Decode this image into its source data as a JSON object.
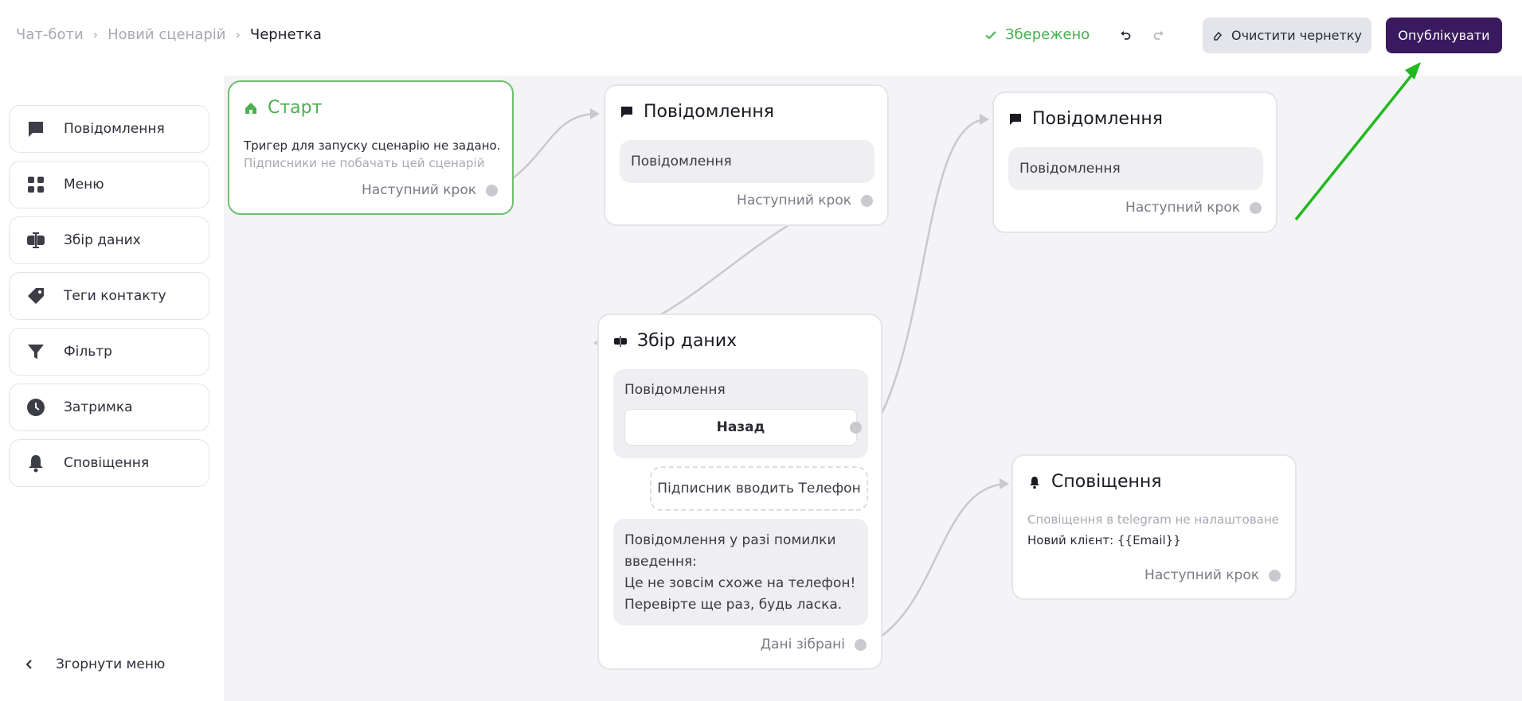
{
  "breadcrumb": {
    "item1": "Чат-боти",
    "item2": "Новий сценарій",
    "current": "Чернетка"
  },
  "header": {
    "saved": "Збережено",
    "clear_label": "Очистити чернетку",
    "publish_label": "Опублікувати"
  },
  "sidebar": {
    "items": [
      {
        "label": "Повідомлення",
        "icon": "message-icon"
      },
      {
        "label": "Меню",
        "icon": "grid-icon"
      },
      {
        "label": "Збір даних",
        "icon": "input-icon"
      },
      {
        "label": "Теги контакту",
        "icon": "tag-icon"
      },
      {
        "label": "Фільтр",
        "icon": "filter-icon"
      },
      {
        "label": "Затримка",
        "icon": "clock-icon"
      },
      {
        "label": "Сповіщення",
        "icon": "bell-icon"
      }
    ],
    "collapse_label": "Згорнути меню"
  },
  "nodes": {
    "start": {
      "title": "Старт",
      "trigger_text": "Тригер для запуску сценарію не задано.",
      "hint": "Підписники не побачать цей сценарій",
      "next": "Наступний крок"
    },
    "message1": {
      "title": "Повідомлення",
      "content": "Повідомлення",
      "next": "Наступний крок"
    },
    "message2": {
      "title": "Повідомлення",
      "content": "Повідомлення",
      "next": "Наступний крок"
    },
    "data": {
      "title": "Збір даних",
      "message": "Повідомлення",
      "button": "Назад",
      "input": "Підписник вводить Телефон",
      "error_line1": "Повідомлення у разі помилки",
      "error_line2": "введення:",
      "error_line3": "Це не зовсім схоже на телефон!",
      "error_line4": "Перевірте ще раз, будь ласка.",
      "done": "Дані зібрані"
    },
    "notify": {
      "title": "Сповіщення",
      "hint": "Сповіщення в telegram не налаштоване",
      "text": "Новий клієнт: {{Email}}",
      "next": "Наступний крок"
    }
  },
  "colors": {
    "accent": "#3a1a5e",
    "success": "#4caf50",
    "arrow": "#22b822"
  }
}
